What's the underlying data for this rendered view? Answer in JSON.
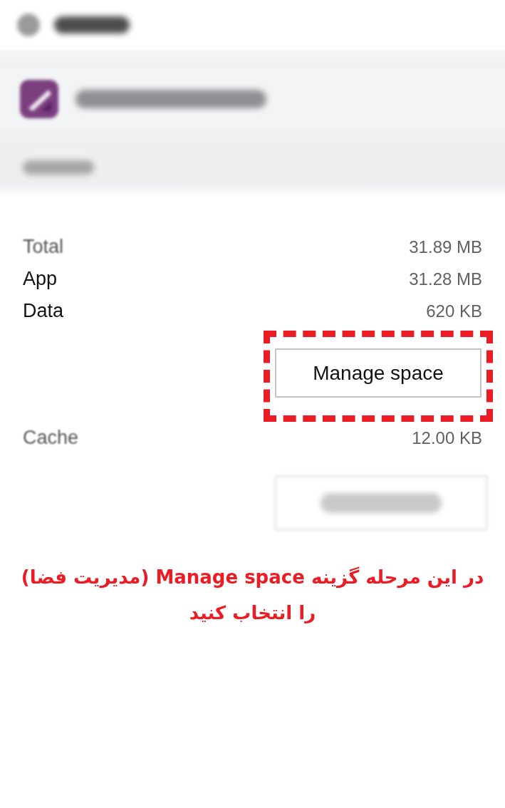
{
  "storage_rows": [
    {
      "label": "Total",
      "value": "31.89 MB",
      "blurred": true
    },
    {
      "label": "App",
      "value": "31.28 MB",
      "blurred": false
    },
    {
      "label": "Data",
      "value": "620 KB",
      "blurred": false
    }
  ],
  "manage_space_button": {
    "label": "Manage space",
    "highlighted": true
  },
  "cache_row": {
    "label": "Cache",
    "value": "12.00 KB",
    "blurred": true
  },
  "instruction": "در این مرحله گزینه Manage space (مدیریت فضا) را انتخاب کنید"
}
